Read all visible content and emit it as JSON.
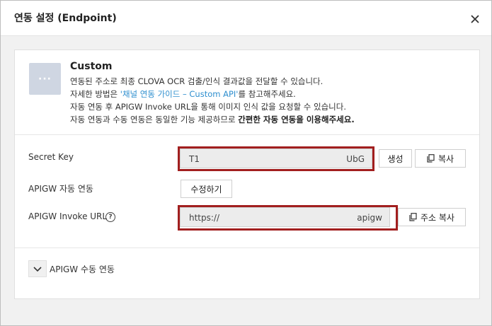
{
  "dialog": {
    "title": "연동 설정 (Endpoint)"
  },
  "custom": {
    "icon_text": "···",
    "title": "Custom",
    "desc1": "연동된 주소로 최종 CLOVA OCR 검출/인식 결과값을 전달할 수 있습니다.",
    "desc2_pre": "자세한 방법은 ",
    "desc2_link": "'채널 연동 가이드 – Custom API'",
    "desc2_post": "를 참고해주세요.",
    "desc3": "자동 연동 후 APIGW Invoke URL을 통해 이미지 인식 값을 요청할 수 있습니다.",
    "desc4_pre": "자동 연동과 수동 연동은 동일한 기능 제공하므로 ",
    "desc4_bold": "간편한 자동 연동을 이용해주세요."
  },
  "secret_key": {
    "label": "Secret Key",
    "value_start": "T1",
    "value_end": "UbG",
    "generate_label": "생성",
    "copy_label": "복사"
  },
  "apigw_auto": {
    "label": "APIGW 자동 연동",
    "edit_label": "수정하기"
  },
  "invoke_url": {
    "label": "APIGW Invoke URL",
    "help_text": "?",
    "value_start": "https://",
    "value_end": "apigw",
    "copy_label": "주소 복사"
  },
  "apigw_manual": {
    "label": "APIGW 수동 연동"
  },
  "colors": {
    "highlight": "#a21f1f",
    "link": "#2f8fcf",
    "icon_bg": "#cfd6e2"
  }
}
